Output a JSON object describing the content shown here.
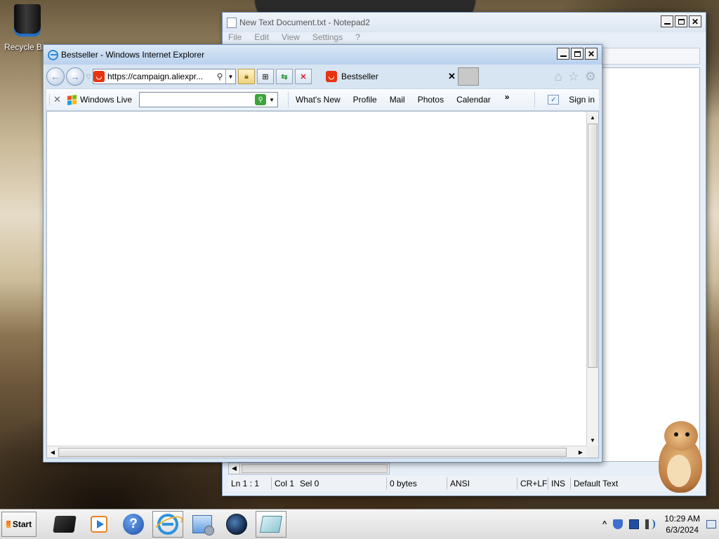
{
  "desktop": {
    "icons": [
      {
        "label": "Recycle Bin",
        "icon": "recycle-bin-icon"
      }
    ]
  },
  "notepad": {
    "title": "New Text Document.txt - Notepad2",
    "menu": [
      "File",
      "Edit",
      "View",
      "Settings",
      "?"
    ],
    "status": {
      "ln": "Ln 1 : 1",
      "col": "Col 1",
      "sel": "Sel 0",
      "size": "0 bytes",
      "encoding": "ANSI",
      "line_ending": "CR+LF",
      "mode": "INS",
      "scheme": "Default Text"
    }
  },
  "ie": {
    "title": "Bestseller - Windows Internet Explorer",
    "address": "https://campaign.aliexpr...",
    "tab_label": "Bestseller",
    "toolbar": {
      "brand": "Windows Live",
      "search_value": "",
      "links": [
        "What's New",
        "Profile",
        "Mail",
        "Photos",
        "Calendar"
      ],
      "more": "»",
      "sign_in": "Sign in"
    }
  },
  "taskbar": {
    "start_label": "Start",
    "apps": [
      "cube-app-icon",
      "media-center-icon",
      "help-icon",
      "internet-explorer-icon",
      "network-icon",
      "globe-icon",
      "notepad-icon"
    ],
    "clock_time": "10:29 AM",
    "clock_date": "6/3/2024"
  },
  "colors": {
    "accent": "#2b8ad9",
    "favicon": "#e8330f",
    "titlebar": "#c8dcf2"
  }
}
